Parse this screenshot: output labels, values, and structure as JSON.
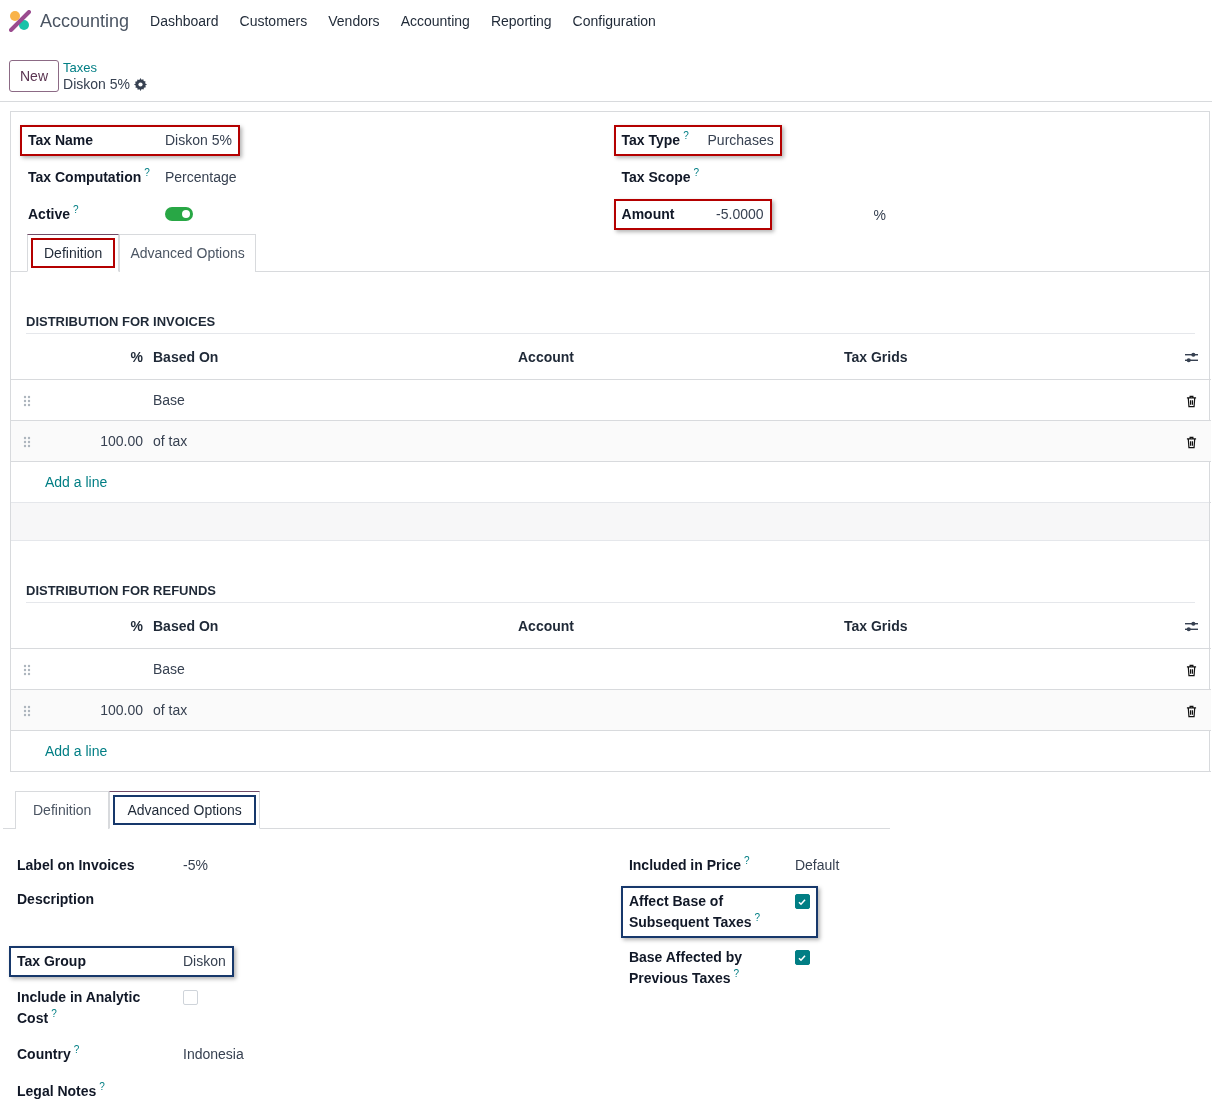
{
  "navbar": {
    "app_name": "Accounting",
    "menu": [
      "Dashboard",
      "Customers",
      "Vendors",
      "Accounting",
      "Reporting",
      "Configuration"
    ]
  },
  "control_panel": {
    "new_button": "New",
    "breadcrumb": "Taxes",
    "record_name": "Diskon 5%"
  },
  "definition_view": {
    "left_fields": [
      {
        "kind": "text",
        "label": "Tax Name",
        "value": "Diskon 5%",
        "highlighted": true
      },
      {
        "kind": "text",
        "label": "Tax Computation",
        "help": "?",
        "value": "Percentage",
        "highlighted": false
      },
      {
        "kind": "toggle",
        "label": "Active",
        "help": "?",
        "on": true,
        "highlighted": false
      }
    ],
    "right_fields": [
      {
        "kind": "text",
        "label": "Tax Type",
        "help": "?",
        "value": "Purchases",
        "highlighted": true
      },
      {
        "kind": "note",
        "label": "Tax Scope",
        "help": "?",
        "highlighted": false
      },
      {
        "kind": "amount",
        "label": "Amount",
        "value": "-5.0000",
        "unit": "%",
        "highlighted": true
      }
    ],
    "tabs": [
      {
        "label": "Definition",
        "selected": true,
        "highlighted": true
      },
      {
        "label": "Advanced Options",
        "selected": false,
        "highlighted": false
      }
    ],
    "sections": [
      {
        "title": "DISTRIBUTION FOR INVOICES",
        "columns": [
          "%",
          "Based On",
          "Account",
          "Tax Grids"
        ],
        "rows": [
          {
            "based_on": "Base"
          },
          {
            "percent": "100.00",
            "based_on": "of tax"
          }
        ],
        "add_line": "Add a line"
      },
      {
        "title": "DISTRIBUTION FOR REFUNDS",
        "columns": [
          "%",
          "Based On",
          "Account",
          "Tax Grids"
        ],
        "rows": [
          {
            "based_on": "Base"
          },
          {
            "percent": "100.00",
            "based_on": "of tax"
          }
        ],
        "add_line": "Add a line"
      }
    ]
  },
  "advanced_view": {
    "tabs": [
      {
        "label": "Definition",
        "selected": false,
        "highlighted": false
      },
      {
        "label": "Advanced Options",
        "selected": true,
        "highlighted": true
      }
    ],
    "left_fields": [
      {
        "kind": "text",
        "label": "Label on Invoices",
        "value": "-5%",
        "highlighted": false
      },
      {
        "kind": "note",
        "label": "Description",
        "highlighted": false
      },
      {
        "kind": "text",
        "label": "Tax Group",
        "value": "Diskon",
        "highlighted": true
      },
      {
        "kind": "checkbox",
        "label": "Include in Analytic Cost",
        "help": "?",
        "checked": false,
        "highlighted": false
      },
      {
        "kind": "text",
        "label": "Country",
        "help": "?",
        "value": "Indonesia",
        "highlighted": false
      },
      {
        "kind": "text",
        "label": "Legal Notes",
        "help": "?",
        "highlighted": false
      }
    ],
    "right_fields": [
      {
        "kind": "text",
        "label": "Included in Price",
        "help": "?",
        "value": "Default",
        "highlighted": false
      },
      {
        "kind": "checkbox",
        "label": "Affect Base of Subsequent Taxes",
        "help": "?",
        "checked": true,
        "highlighted": true
      },
      {
        "kind": "checkbox",
        "label": "Base Affected by Previous Taxes",
        "help": "?",
        "checked": true,
        "highlighted": false
      }
    ]
  }
}
